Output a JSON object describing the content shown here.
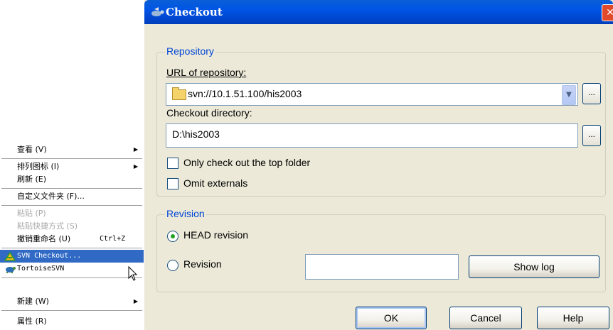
{
  "context_menu": {
    "items": [
      {
        "label": "查看 (V)",
        "submenu": true
      },
      {
        "label": "排列图标 (I)",
        "submenu": true
      },
      {
        "label": "刷新 (E)"
      },
      {
        "label": "自定义文件夹 (F)..."
      },
      {
        "label": "粘贴 (P)",
        "disabled": true
      },
      {
        "label": "粘贴快捷方式 (S)",
        "disabled": true
      },
      {
        "label": "撤销重命名 (U)",
        "shortcut": "Ctrl+Z"
      },
      {
        "label": "SVN Checkout...",
        "highlighted": true,
        "icon": "svn-checkout-icon"
      },
      {
        "label": "TortoiseSVN",
        "submenu": true,
        "icon": "tortoise-icon"
      },
      {
        "label": "新建 (W)",
        "submenu": true
      },
      {
        "label": "属性 (R)"
      }
    ],
    "submenu_arrow": "▶"
  },
  "dialog": {
    "title": "Checkout",
    "close_symbol": "✕",
    "repository": {
      "group_label": "Repository",
      "url_label": "URL of repository:",
      "url_value": "svn://10.1.51.100/his2003",
      "dropdown_symbol": "▼",
      "browse_label": "...",
      "dir_label": "Checkout directory:",
      "dir_value": "D:\\his2003",
      "only_top_folder_label": "Only check out the top folder",
      "only_top_folder_checked": false,
      "omit_externals_label": "Omit externals",
      "omit_externals_checked": false
    },
    "revision": {
      "group_label": "Revision",
      "head_label": "HEAD revision",
      "head_selected": true,
      "revision_label": "Revision",
      "revision_selected": false,
      "revision_value": "",
      "show_log_label": "Show log"
    },
    "buttons": {
      "ok": "OK",
      "cancel": "Cancel",
      "help": "Help"
    }
  },
  "colors": {
    "dialog_bg": "#ece9d8",
    "titlebar": "#0055e5",
    "group_title": "#0046d5",
    "menu_highlight": "#316ac5"
  }
}
